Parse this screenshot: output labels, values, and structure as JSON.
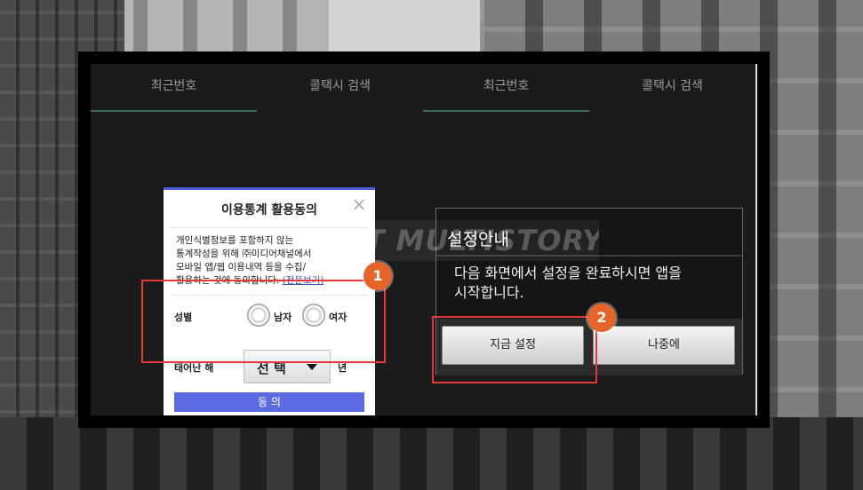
{
  "tabs": [
    {
      "label": "최근번호",
      "active": true
    },
    {
      "label": "콜택시 검색",
      "active": false
    },
    {
      "label": "최근번호",
      "active": true
    },
    {
      "label": "콜택시 검색",
      "active": false
    }
  ],
  "consent_dialog": {
    "title": "이용통계 활용동의",
    "close_icon": "×",
    "body_lines": [
      "개인식별정보를 포함하지 않는",
      "통계작성을 위해 ㈜미디어채널에서",
      "모바일 앱/웹 이용내역 등을 수집/",
      "활용하는 것에 동의합니다."
    ],
    "link_text": "(전문보기)",
    "gender_label": "성별",
    "gender_options": [
      "남자",
      "여자"
    ],
    "birth_label": "태어난 해",
    "birth_select_value": "선 택",
    "birth_suffix": "년",
    "agree_label": "동 의"
  },
  "settings_dialog": {
    "title": "설정안내",
    "body_lines": [
      "다음 화면에서 설정을 완료하시면 앱을",
      "시작합니다."
    ],
    "buttons": {
      "set_now": "지금 설정",
      "later": "나중에"
    }
  },
  "watermark": "NET MULTISTORY",
  "annotations": {
    "badge_1": "1",
    "badge_2": "2",
    "color": "#e23a3a",
    "badge_color": "#e6632a"
  },
  "colors": {
    "accent_blue": "#4a5fd9",
    "tab_underline": "#3d6e58"
  }
}
